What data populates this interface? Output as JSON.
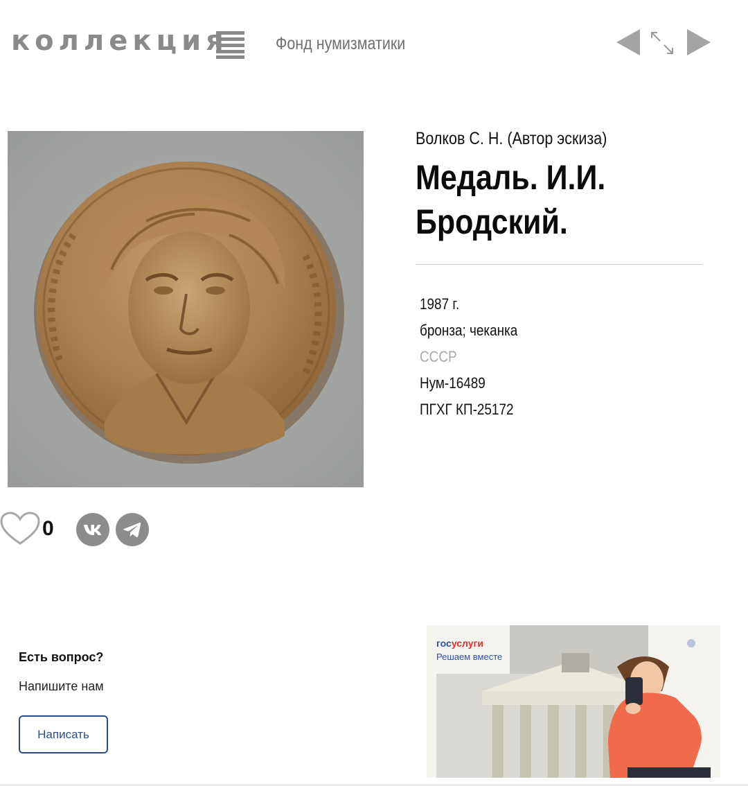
{
  "header": {
    "logo": "коллекция",
    "section": "Фонд нумизматики"
  },
  "item": {
    "author": "Волков С. Н. (Автор эскиза)",
    "title": "Медаль. И.И. Бродский.",
    "date": "1987 г.",
    "material": "бронза; чеканка",
    "country": "СССР",
    "inventory": "Нум-16489",
    "registry": "ПГХГ КП-25172"
  },
  "actions": {
    "likes": "0"
  },
  "feedback": {
    "question": "Есть вопрос?",
    "prompt": "Напишите нам",
    "button": "Написать"
  },
  "banner": {
    "brand_part1": "гос",
    "brand_part2": "услуги",
    "slogan": "Решаем вместе"
  },
  "colors": {
    "accent_gray": "#8a8a8a",
    "button_blue": "#2b4c8c",
    "banner_blue": "#2b4fb3",
    "banner_red": "#e1302f"
  }
}
